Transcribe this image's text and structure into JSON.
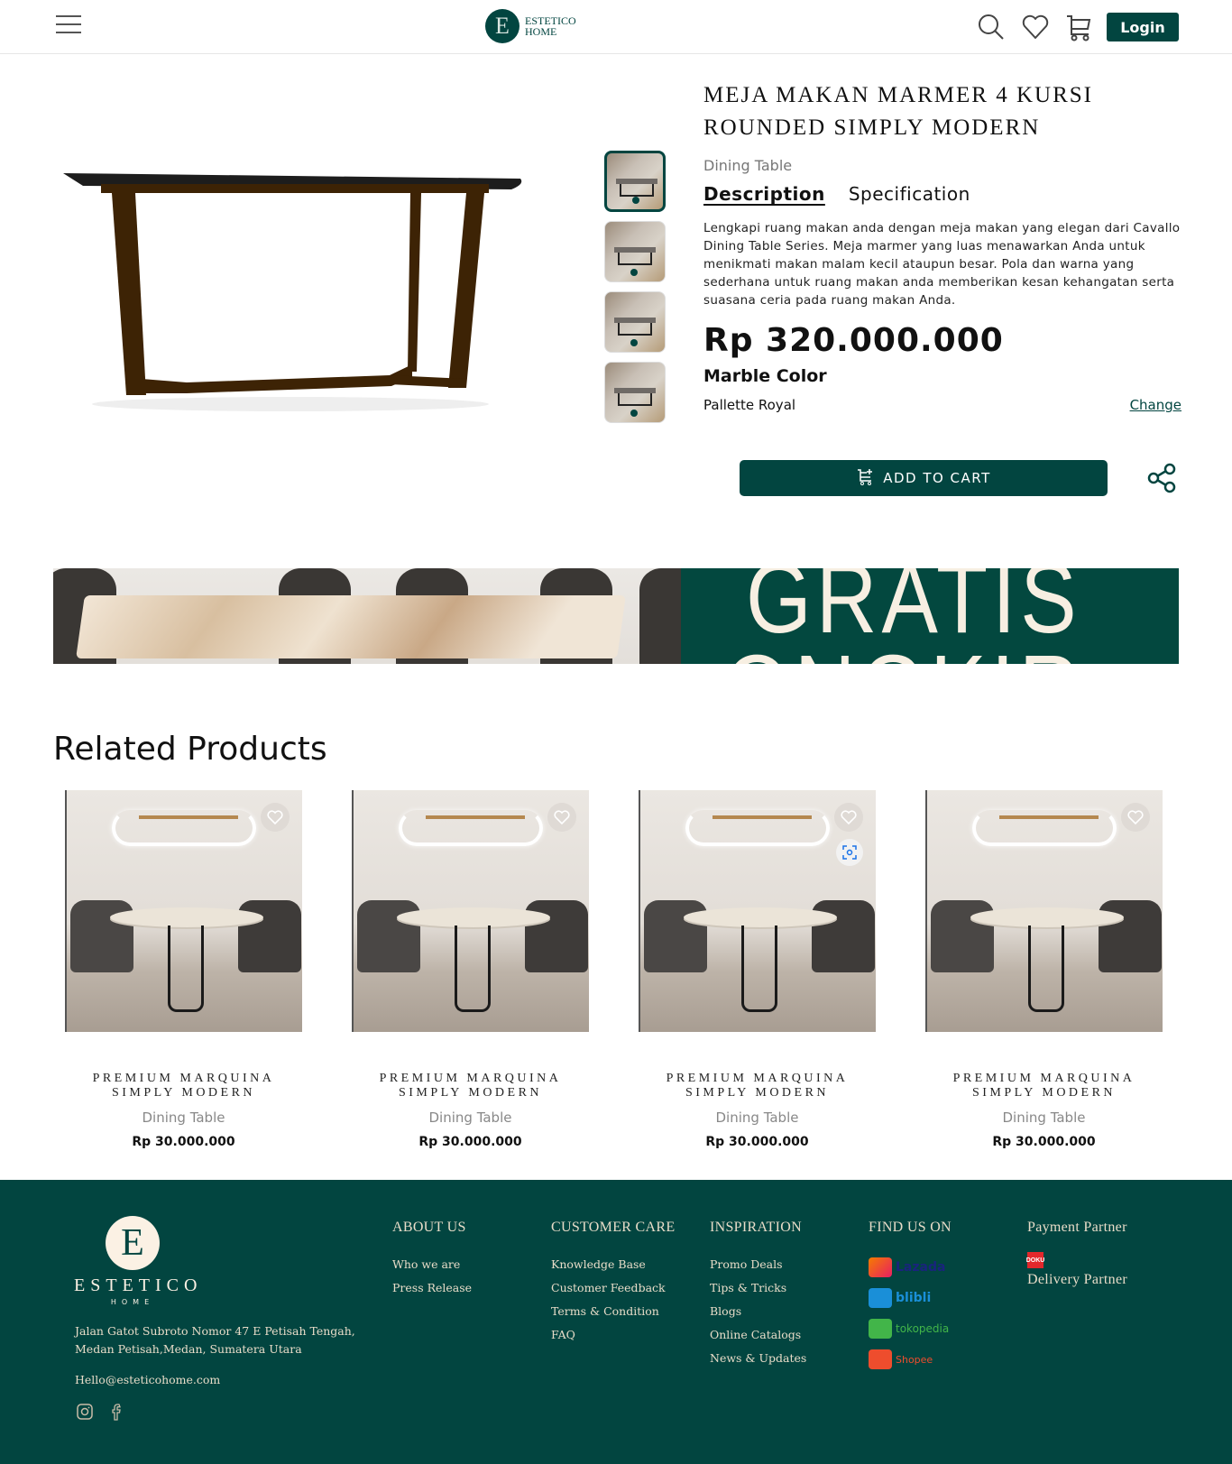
{
  "header": {
    "menu_icon": "hamburger-icon",
    "logo_mark": "E",
    "logo_line1": "ESTETICO",
    "logo_line2": "HOME",
    "icons": [
      "search-icon",
      "heart-icon",
      "cart-icon"
    ],
    "login_label": "Login"
  },
  "product": {
    "title_line1": "MEJA MAKAN MARMER 4 KURSI",
    "title_line2": "ROUNDED SIMPLY MODERN",
    "category": "Dining Table",
    "tabs": [
      {
        "label": "Description",
        "active": true
      },
      {
        "label": "Specification",
        "active": false
      }
    ],
    "description": "Lengkapi ruang makan anda dengan meja makan yang elegan dari Cavallo Dining Table Series. Meja marmer yang luas menawarkan Anda untuk menikmati makan malam kecil ataupun besar. Pola dan warna yang sederhana untuk ruang makan anda memberikan kesan kehangatan serta suasana ceria pada ruang makan Anda.",
    "price": "Rp 320.000.000",
    "option_label": "Marble Color",
    "option_value": "Pallette Royal",
    "change_label": "Change",
    "add_to_cart_label": "ADD TO CART",
    "thumbnail_count": 4,
    "active_thumbnail": 1
  },
  "banner": {
    "text_line1": "GRATIS",
    "text_line2": "ONGKIR"
  },
  "related": {
    "title": "Related Products",
    "items": [
      {
        "name_line1": "PREMIUM MARQUINA",
        "name_line2": "SIMPLY MODERN",
        "category": "Dining Table",
        "price": "Rp 30.000.000"
      },
      {
        "name_line1": "PREMIUM MARQUINA",
        "name_line2": "SIMPLY MODERN",
        "category": "Dining Table",
        "price": "Rp 30.000.000"
      },
      {
        "name_line1": "PREMIUM MARQUINA",
        "name_line2": "SIMPLY MODERN",
        "category": "Dining Table",
        "price": "Rp 30.000.000"
      },
      {
        "name_line1": "PREMIUM MARQUINA",
        "name_line2": "SIMPLY MODERN",
        "category": "Dining Table",
        "price": "Rp 30.000.000"
      }
    ]
  },
  "footer": {
    "brand": "ESTETICO",
    "brand_sub": "HOME",
    "logo_mark": "E",
    "address": "Jalan Gatot Subroto Nomor 47 E Petisah Tengah, Medan Petisah,Medan, Sumatera Utara",
    "email": "Hello@esteticohome.com",
    "social": [
      "instagram-icon",
      "facebook-icon"
    ],
    "about": {
      "title": "ABOUT US",
      "links": [
        "Who we are",
        "Press Release"
      ]
    },
    "care": {
      "title": "CUSTOMER CARE",
      "links": [
        "Knowledge Base",
        "Customer Feedback",
        "Terms & Condition",
        "FAQ"
      ]
    },
    "inspiration": {
      "title": "INSPIRATION",
      "links": [
        "Promo Deals",
        "Tips & Tricks",
        "Blogs",
        "Online Catalogs",
        "News & Updates"
      ]
    },
    "find_us": {
      "title": "FIND US ON",
      "stores": [
        "Lazada",
        "blibli",
        "tokopedia",
        "Shopee"
      ]
    },
    "payment": {
      "title": "Payment Partner",
      "partner": "DOKU"
    },
    "delivery": {
      "title": "Delivery Partner"
    }
  },
  "colors": {
    "brand_green": "#024540",
    "footer_text": "#e8dcc8",
    "banner_cream": "#f7efe2"
  }
}
